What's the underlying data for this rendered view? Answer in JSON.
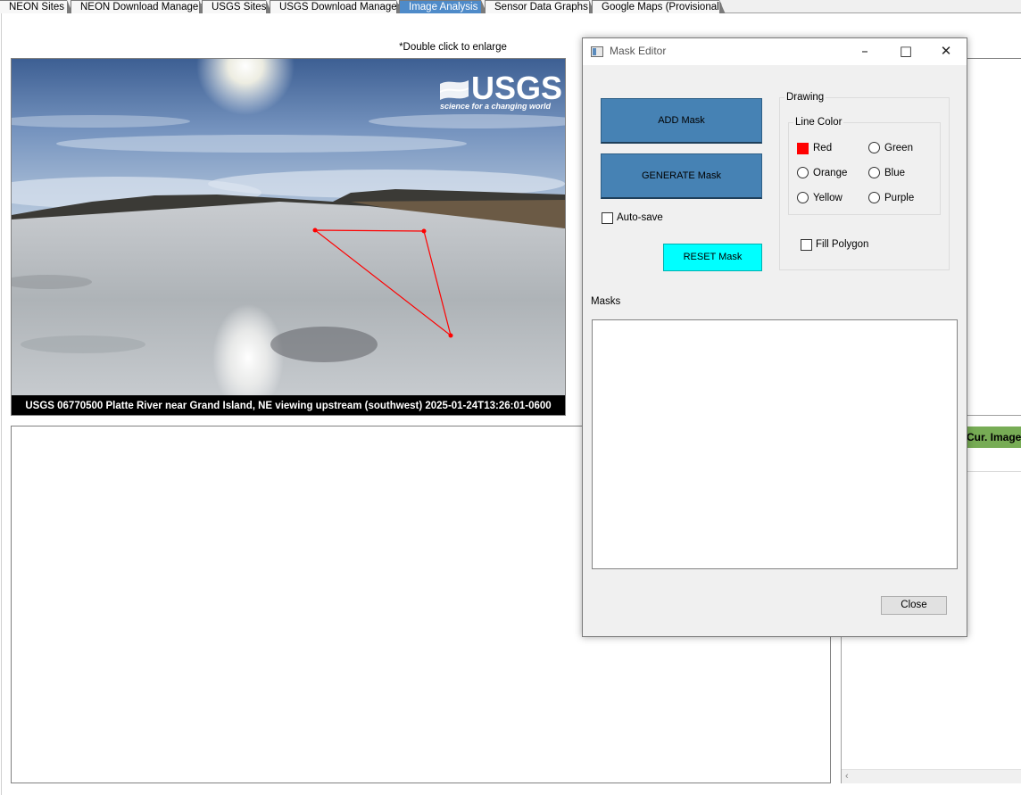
{
  "tabs": [
    {
      "label": "NEON Sites",
      "active": false
    },
    {
      "label": "NEON Download Manager",
      "active": false
    },
    {
      "label": "USGS Sites",
      "active": false
    },
    {
      "label": "USGS Download Manager",
      "active": false
    },
    {
      "label": "Image Analysis",
      "active": true
    },
    {
      "label": "Sensor Data Graphs",
      "active": false
    },
    {
      "label": "Google Maps (Provisional)",
      "active": false
    }
  ],
  "main": {
    "hint": "*Double click to enlarge",
    "image": {
      "logo_text": "USGS",
      "logo_tagline": "science for a changing world",
      "caption": "USGS 06770500 Platte River near Grand Island, NE viewing upstream (southwest) 2025-01-24T13:26:01-0600",
      "polygon_color": "#ff0000"
    },
    "right_table": {
      "header": "Cur. Image",
      "header_color": "#77ac55"
    }
  },
  "dialog": {
    "title": "Mask Editor",
    "add_mask": "ADD Mask",
    "generate_mask": "GENERATE Mask",
    "autosave_label": "Auto-save",
    "autosave_checked": false,
    "reset_mask": "RESET Mask",
    "drawing_group": "Drawing",
    "line_color_group": "Line Color",
    "colors": [
      {
        "label": "Red",
        "selected": true
      },
      {
        "label": "Green",
        "selected": false
      },
      {
        "label": "Orange",
        "selected": false
      },
      {
        "label": "Blue",
        "selected": false
      },
      {
        "label": "Yellow",
        "selected": false
      },
      {
        "label": "Purple",
        "selected": false
      }
    ],
    "fill_polygon_label": "Fill Polygon",
    "fill_polygon_checked": false,
    "masks_label": "Masks",
    "masks": [],
    "close_label": "Close"
  }
}
